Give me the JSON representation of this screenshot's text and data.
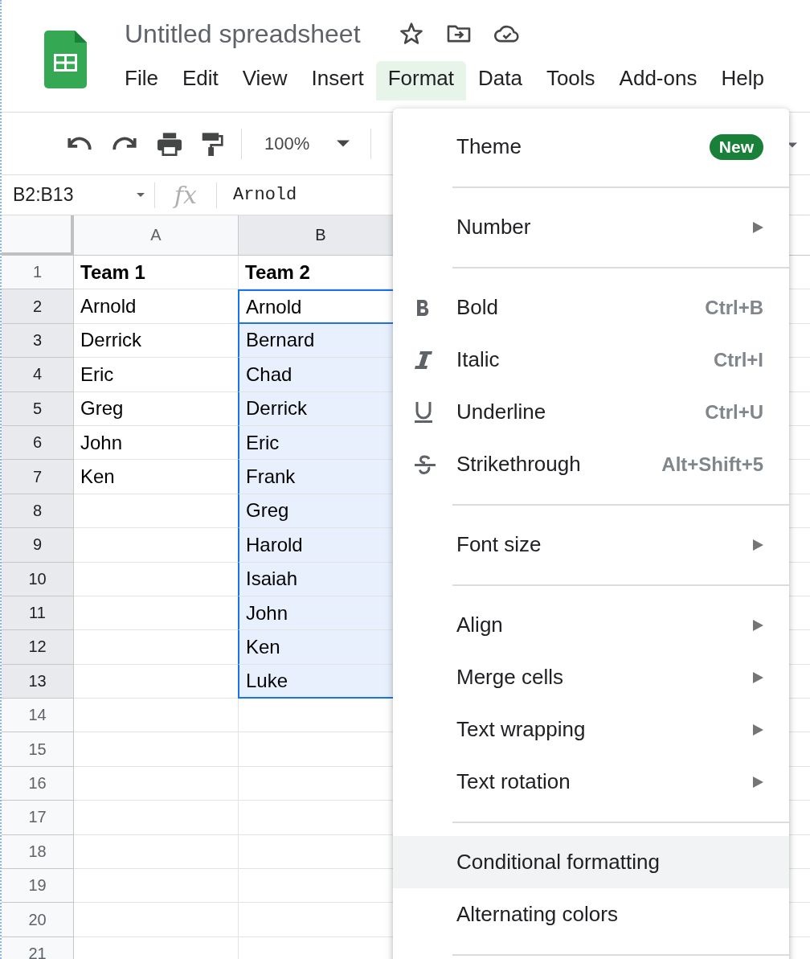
{
  "document": {
    "title": "Untitled spreadsheet"
  },
  "menubar": [
    {
      "label": "File",
      "selected": false
    },
    {
      "label": "Edit",
      "selected": false
    },
    {
      "label": "View",
      "selected": false
    },
    {
      "label": "Insert",
      "selected": false
    },
    {
      "label": "Format",
      "selected": true
    },
    {
      "label": "Data",
      "selected": false
    },
    {
      "label": "Tools",
      "selected": false
    },
    {
      "label": "Add-ons",
      "selected": false
    },
    {
      "label": "Help",
      "selected": false
    }
  ],
  "toolbar": {
    "zoom": "100%"
  },
  "formula_bar": {
    "name_box": "B2:B13",
    "fx": "fx",
    "value": "Arnold"
  },
  "grid": {
    "columns": [
      {
        "label": "A",
        "selected": false
      },
      {
        "label": "B",
        "selected": true
      }
    ],
    "rows": [
      {
        "number": "1",
        "selected": false,
        "active": false,
        "cells": [
          "Team 1",
          "Team 2"
        ]
      },
      {
        "number": "2",
        "selected": true,
        "active": true,
        "cells": [
          "Arnold",
          "Arnold"
        ]
      },
      {
        "number": "3",
        "selected": true,
        "active": false,
        "cells": [
          "Derrick",
          "Bernard"
        ]
      },
      {
        "number": "4",
        "selected": true,
        "active": false,
        "cells": [
          "Eric",
          "Chad"
        ]
      },
      {
        "number": "5",
        "selected": true,
        "active": false,
        "cells": [
          "Greg",
          "Derrick"
        ]
      },
      {
        "number": "6",
        "selected": true,
        "active": false,
        "cells": [
          "John",
          "Eric"
        ]
      },
      {
        "number": "7",
        "selected": true,
        "active": false,
        "cells": [
          "Ken",
          "Frank"
        ]
      },
      {
        "number": "8",
        "selected": true,
        "active": false,
        "cells": [
          "",
          "Greg"
        ]
      },
      {
        "number": "9",
        "selected": true,
        "active": false,
        "cells": [
          "",
          "Harold"
        ]
      },
      {
        "number": "10",
        "selected": true,
        "active": false,
        "cells": [
          "",
          "Isaiah"
        ]
      },
      {
        "number": "11",
        "selected": true,
        "active": false,
        "cells": [
          "",
          "John"
        ]
      },
      {
        "number": "12",
        "selected": true,
        "active": false,
        "cells": [
          "",
          "Ken"
        ]
      },
      {
        "number": "13",
        "selected": true,
        "active": false,
        "cells": [
          "",
          "Luke"
        ]
      },
      {
        "number": "14",
        "selected": false,
        "active": false,
        "cells": [
          "",
          ""
        ]
      },
      {
        "number": "15",
        "selected": false,
        "active": false,
        "cells": [
          "",
          ""
        ]
      },
      {
        "number": "16",
        "selected": false,
        "active": false,
        "cells": [
          "",
          ""
        ]
      },
      {
        "number": "17",
        "selected": false,
        "active": false,
        "cells": [
          "",
          ""
        ]
      },
      {
        "number": "18",
        "selected": false,
        "active": false,
        "cells": [
          "",
          ""
        ]
      },
      {
        "number": "19",
        "selected": false,
        "active": false,
        "cells": [
          "",
          ""
        ]
      },
      {
        "number": "20",
        "selected": false,
        "active": false,
        "cells": [
          "",
          ""
        ]
      },
      {
        "number": "21",
        "selected": false,
        "active": false,
        "cells": [
          "",
          ""
        ]
      }
    ]
  },
  "format_menu": [
    {
      "kind": "item",
      "label": "Theme",
      "badge": "New",
      "submenu": false,
      "highlighted": false
    },
    {
      "kind": "separator"
    },
    {
      "kind": "item",
      "label": "Number",
      "submenu": true,
      "highlighted": false
    },
    {
      "kind": "separator"
    },
    {
      "kind": "style",
      "label": "Bold",
      "shortcut": "Ctrl+B",
      "submenu": false,
      "highlighted": false
    },
    {
      "kind": "style",
      "label": "Italic",
      "shortcut": "Ctrl+I",
      "submenu": false,
      "highlighted": false
    },
    {
      "kind": "style",
      "label": "Underline",
      "shortcut": "Ctrl+U",
      "submenu": false,
      "highlighted": false
    },
    {
      "kind": "style",
      "label": "Strikethrough",
      "shortcut": "Alt+Shift+5",
      "submenu": false,
      "highlighted": false
    },
    {
      "kind": "separator"
    },
    {
      "kind": "item",
      "label": "Font size",
      "submenu": true,
      "highlighted": false
    },
    {
      "kind": "separator"
    },
    {
      "kind": "item",
      "label": "Align",
      "submenu": true,
      "highlighted": false
    },
    {
      "kind": "item",
      "label": "Merge cells",
      "submenu": true,
      "highlighted": false
    },
    {
      "kind": "item",
      "label": "Text wrapping",
      "submenu": true,
      "highlighted": false
    },
    {
      "kind": "item",
      "label": "Text rotation",
      "submenu": true,
      "highlighted": false
    },
    {
      "kind": "separator"
    },
    {
      "kind": "item",
      "label": "Conditional formatting",
      "submenu": false,
      "highlighted": true
    },
    {
      "kind": "item",
      "label": "Alternating colors",
      "submenu": false,
      "highlighted": false
    },
    {
      "kind": "separator"
    }
  ]
}
